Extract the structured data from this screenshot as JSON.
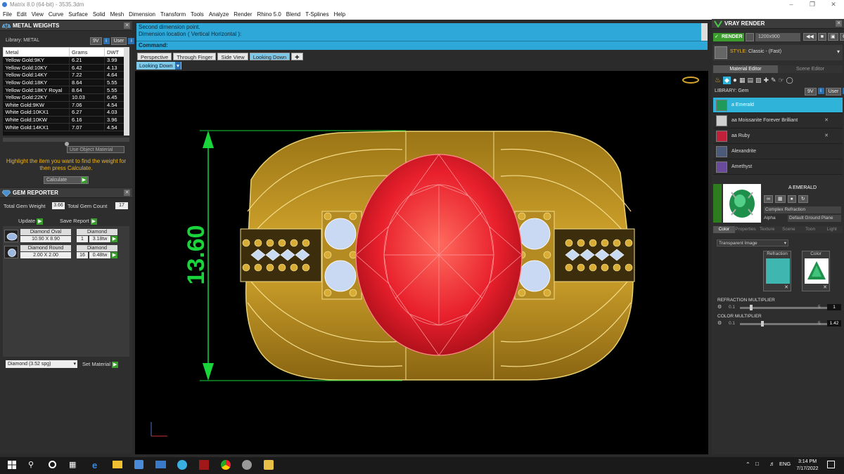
{
  "window": {
    "title": "Matrix 8.0 (64-bit) - 3535.3dm"
  },
  "menu": [
    "File",
    "Edit",
    "View",
    "Curve",
    "Surface",
    "Solid",
    "Mesh",
    "Dimension",
    "Transform",
    "Tools",
    "Analyze",
    "Render",
    "Rhino 5.0",
    "Blend",
    "T-Splines",
    "Help"
  ],
  "metal_weights": {
    "title": "METAL WEIGHTS",
    "library_label": "Library: METAL",
    "btn_9v": "9V",
    "btn_user": "User",
    "columns": [
      "Metal",
      "Grams",
      "DWT"
    ],
    "rows": [
      [
        "Yellow Gold:9KY",
        "6.21",
        "3.99"
      ],
      [
        "Yellow Gold:10KY",
        "6.42",
        "4.13"
      ],
      [
        "Yellow Gold:14KY",
        "7.22",
        "4.64"
      ],
      [
        "Yellow Gold:18KY",
        "8.64",
        "5.55"
      ],
      [
        "Yellow Gold:18KY Royal",
        "8.64",
        "5.55"
      ],
      [
        "Yellow Gold:22KY",
        "10.03",
        "6.45"
      ],
      [
        "White Gold:9KW",
        "7.06",
        "4.54"
      ],
      [
        "White Gold:10KX1",
        "6.27",
        "4.03"
      ],
      [
        "White Gold:10KW",
        "6.16",
        "3.96"
      ],
      [
        "White Gold:14KX1",
        "7.07",
        "4.54"
      ]
    ],
    "use_object_material": "Use Object Material",
    "hint": "Highlight the item you want to find the weight for then press Calculate.",
    "calculate": "Calculate"
  },
  "gem_reporter": {
    "title": "GEM REPORTER",
    "total_weight_label": "Total Gem Weight",
    "total_weight": "3.66",
    "total_count_label": "Total Gem Count",
    "total_count": "17",
    "update": "Update",
    "save_report": "Save Report",
    "gems": [
      {
        "cut": "Diamond Oval",
        "type": "Diamond",
        "size": "10.90 X 8.90",
        "count": "1",
        "weight": "3.18tw"
      },
      {
        "cut": "Diamond Round",
        "type": "Diamond",
        "size": "2.00 X 2.00",
        "count": "16",
        "weight": "0.48tw"
      }
    ],
    "material_select": "Diamond    (3.52 spg)",
    "set_material": "Set Material"
  },
  "command": {
    "line1": "Second dimension point.",
    "line2": "Dimension location ( Vertical  Horizontal ):",
    "label": "Command:"
  },
  "viewport_tabs": [
    "Perspective",
    "Through Finger",
    "Side View",
    "Looking Down"
  ],
  "active_view": "Looking Down",
  "view_dropdown": "Looking Down",
  "dimension_text": "13.60",
  "vray": {
    "title": "VRAY RENDER",
    "render": "RENDER",
    "resolution": "1200x900",
    "style_label": "STYLE:",
    "style_value": "Classic - (Fast)",
    "tab_material": "Material Editor",
    "tab_scene": "Scene Editor",
    "library_label": "LIBRARY: Gem",
    "btn_9v": "9V",
    "btn_user": "User",
    "materials": [
      {
        "name": "a Emerald",
        "color": "#1f9a5a",
        "selected": true
      },
      {
        "name": "aa Moissanite Forever Brilliant",
        "color": "#cfcfcf",
        "selected": false
      },
      {
        "name": "aa Ruby",
        "color": "#c0203a",
        "selected": false
      },
      {
        "name": "Alexandrite",
        "color": "#4a5a78",
        "selected": false
      },
      {
        "name": "Amethyst",
        "color": "#6a4a9a",
        "selected": false
      }
    ],
    "preview_name": "A EMERALD",
    "preview_option": "Complex Refraction",
    "alpha_label": "Alpha",
    "ground": "Default Ground Plane",
    "props_tabs": [
      "Color",
      "Properties",
      "Texture",
      "Scene",
      "Toon",
      "Light"
    ],
    "texture_mode": "Transparent Image",
    "refraction_label": "Refraction",
    "color_label": "Color",
    "refraction_multiplier_label": "REFRACTION MULTIPLIER",
    "refraction_min": "0.1",
    "refraction_max": "5",
    "refraction_value": "1",
    "color_multiplier_label": "COLOR MULTIPLIER",
    "color_min": "0.1",
    "color_max": "5",
    "color_value": "1.42"
  },
  "taskbar": {
    "lang": "ENG",
    "time": "3:14 PM",
    "date": "7/17/2022"
  },
  "colors": {
    "gold": "#d4a52a",
    "ruby": "#e0232e",
    "dimension": "#19d43a",
    "command_bg": "#2ea8d8"
  }
}
